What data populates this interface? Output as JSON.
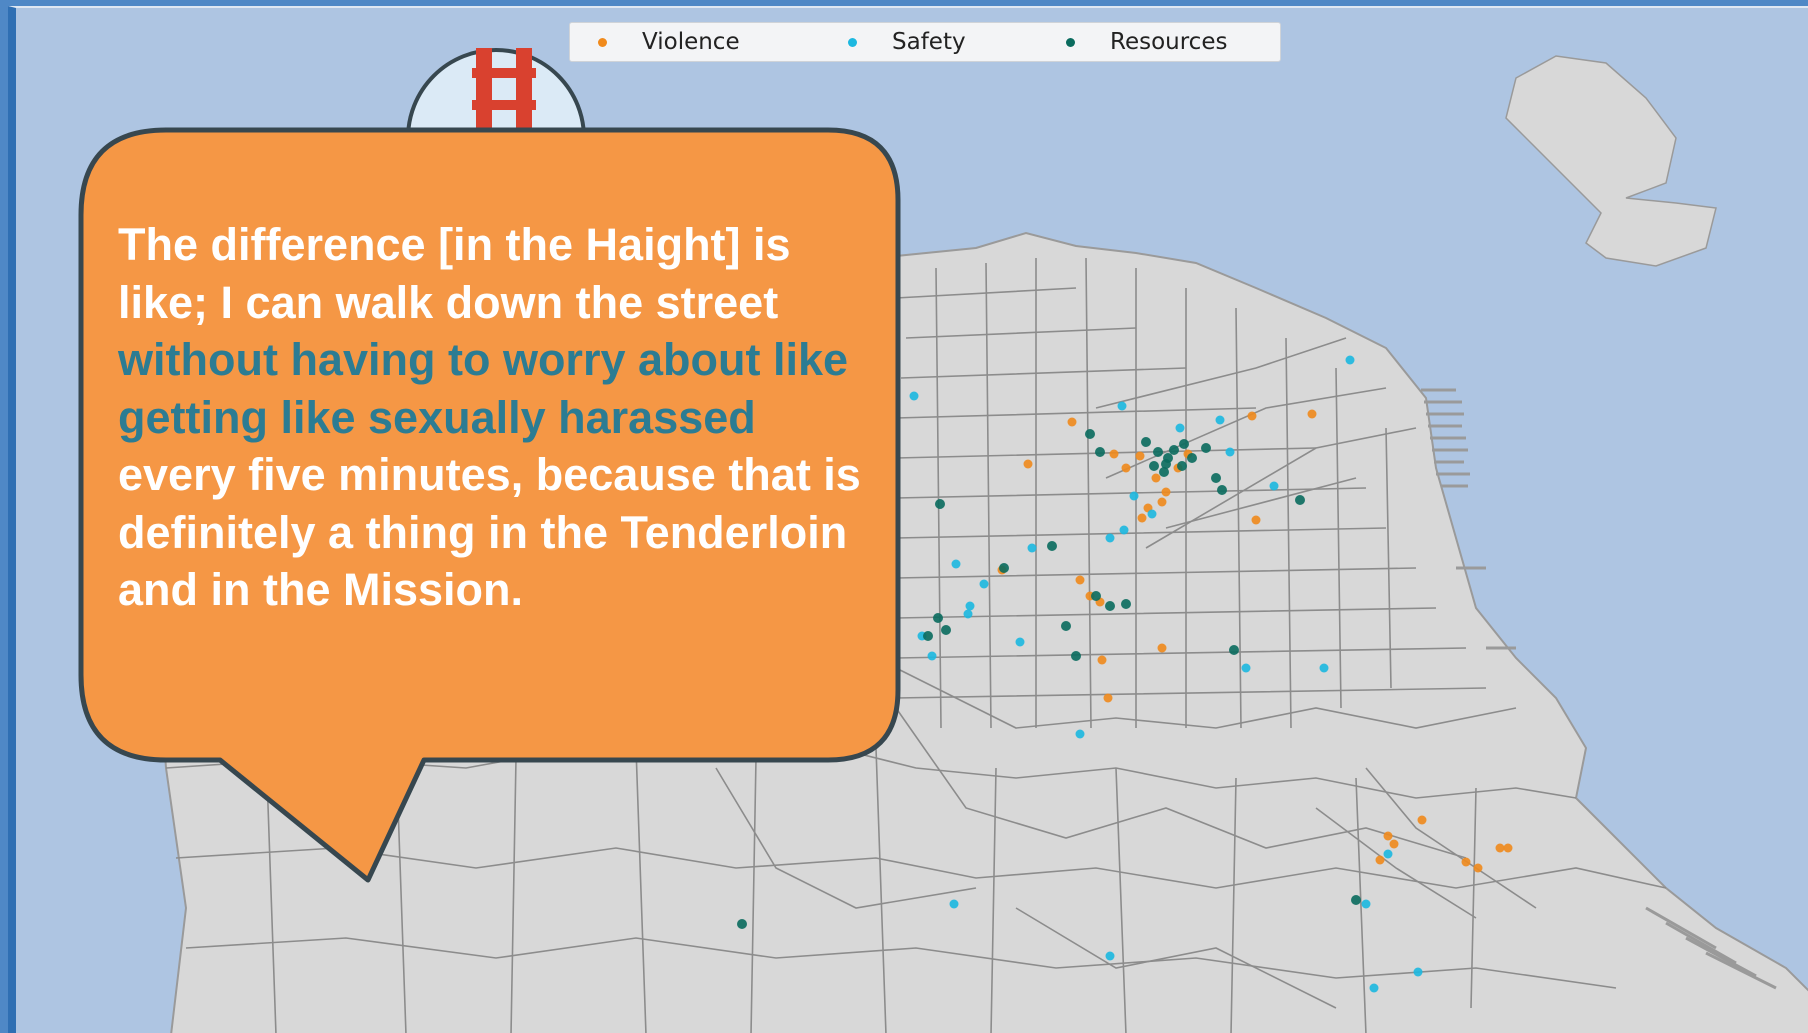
{
  "legend": {
    "items": [
      {
        "label": "Violence",
        "color": "#f08a1c"
      },
      {
        "label": "Safety",
        "color": "#1cb8e0"
      },
      {
        "label": "Resources",
        "color": "#0a6b5e"
      }
    ]
  },
  "quote": {
    "part1": "The difference [in the Haight] is like; I can walk down the street ",
    "highlight": "without having to worry about like getting like sexually harassed",
    "part2": " every five minutes, because that is definitely a thing in the Tenderloin and in the Mission."
  },
  "colors": {
    "water": "#aec5e2",
    "land": "#d8d8d8",
    "boundary": "#8c8c8c",
    "bubble_fill": "#f59745",
    "bubble_stroke": "#37474f",
    "highlight_text": "#2c7c93"
  },
  "icons": {
    "landmark": "golden-gate-bridge-icon"
  }
}
